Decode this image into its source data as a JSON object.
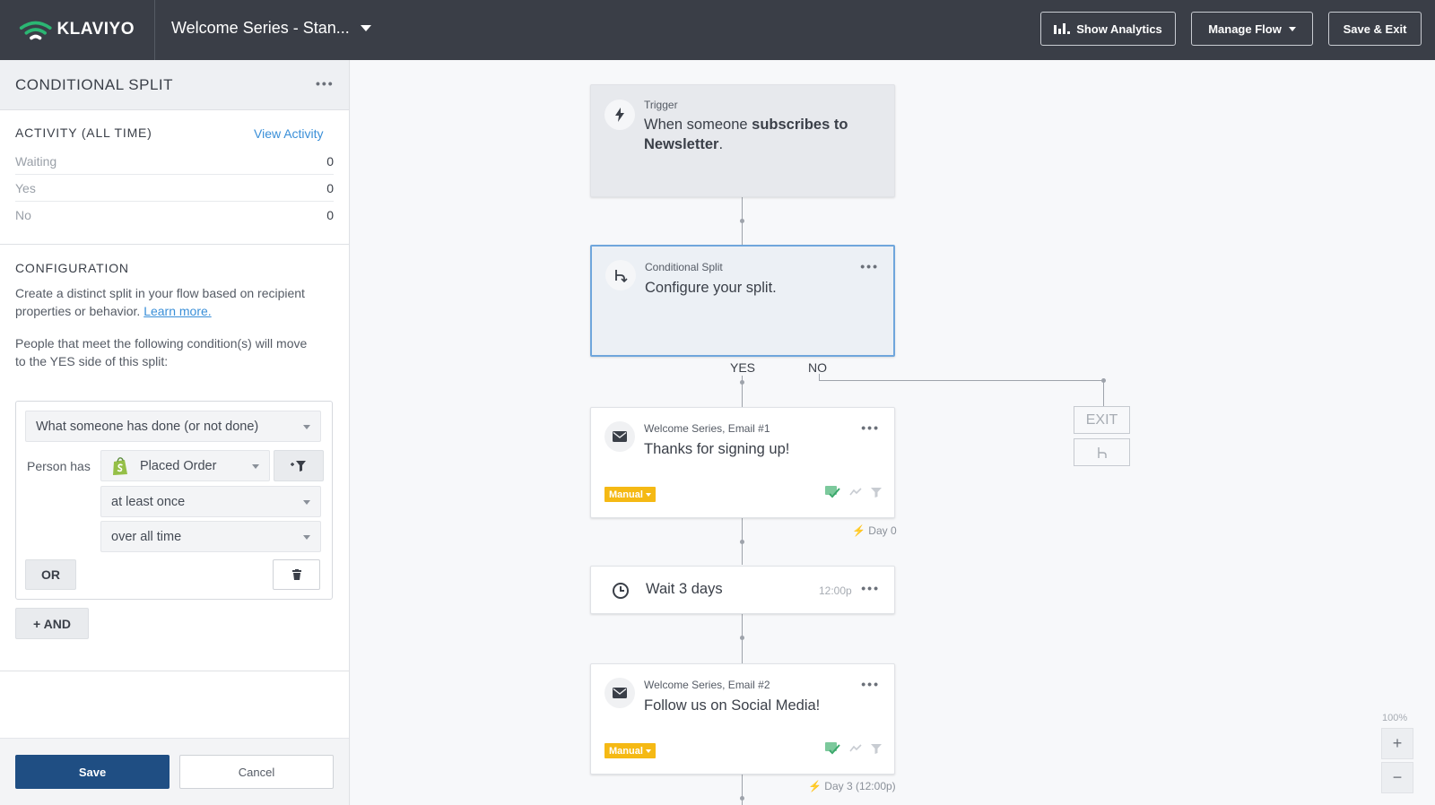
{
  "topbar": {
    "logo_text": "KLAVIYO",
    "flow_name": "Welcome Series - Stan...",
    "show_analytics_label": "Show Analytics",
    "manage_flow_label": "Manage Flow",
    "save_exit_label": "Save & Exit",
    "bg_color": "#3a3e47"
  },
  "panel": {
    "title": "CONDITIONAL SPLIT",
    "activity": {
      "title": "ACTIVITY (ALL TIME)",
      "view_activity": "View Activity",
      "rows": [
        {
          "label": "Waiting",
          "value": "0"
        },
        {
          "label": "Yes",
          "value": "0"
        },
        {
          "label": "No",
          "value": "0"
        }
      ]
    },
    "configuration": {
      "title": "CONFIGURATION",
      "desc_text": "Create a distinct split in your flow based on recipient properties or behavior.",
      "learn_more": "Learn more.",
      "condition_intro": "People that meet the following condition(s) will move to the YES side of this split:"
    },
    "condition": {
      "type_value": "What someone has done (or not done)",
      "person_has_label": "Person has",
      "metric_value": "Placed Order",
      "frequency_value": "at least once",
      "timeframe_value": "over all time",
      "or_label": "OR",
      "and_label": "+ AND"
    },
    "footer": {
      "save_label": "Save",
      "cancel_label": "Cancel"
    }
  },
  "canvas": {
    "trigger": {
      "kicker": "Trigger",
      "text_pre": "When someone ",
      "text_bold": "subscribes to Newsletter",
      "text_post": "."
    },
    "split": {
      "kicker": "Conditional Split",
      "text": "Configure your split.",
      "yes_label": "YES",
      "no_label": "NO"
    },
    "exit_label": "EXIT",
    "email1": {
      "kicker": "Welcome Series, Email #1",
      "text": "Thanks for signing up!",
      "badge": "Manual",
      "day_label": "Day 0"
    },
    "wait": {
      "text": "Wait 3 days",
      "time": "12:00p"
    },
    "email2": {
      "kicker": "Welcome Series, Email #2",
      "text": "Follow us on Social Media!",
      "badge": "Manual",
      "day_label": "Day 3 (12:00p)"
    },
    "zoom": {
      "level": "100%",
      "plus": "+",
      "minus": "−"
    },
    "colors": {
      "accent_blue": "#1f4e83",
      "link_blue": "#3a8fd8",
      "badge_yellow": "#f5b914",
      "selected_border": "#6fa6dc"
    }
  }
}
